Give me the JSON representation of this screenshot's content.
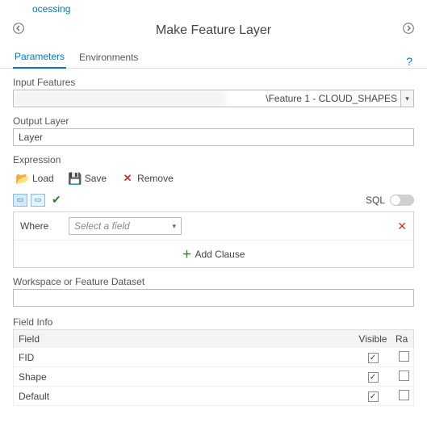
{
  "app_link": "ocessing",
  "title": "Make Feature Layer",
  "tabs": {
    "parameters": "Parameters",
    "environments": "Environments"
  },
  "labels": {
    "input_features": "Input Features",
    "output_layer": "Output Layer",
    "expression": "Expression",
    "workspace": "Workspace or Feature Dataset",
    "field_info": "Field Info"
  },
  "toolbar": {
    "load": "Load",
    "save": "Save",
    "remove": "Remove"
  },
  "sql": "SQL",
  "clause": {
    "where": "Where",
    "placeholder": "Select a field",
    "add": "Add Clause"
  },
  "input_features_value": "\\Feature 1 - CLOUD_SHAPES",
  "output_layer_value": "Layer",
  "workspace_value": "",
  "columns": {
    "field": "Field",
    "visible": "Visible",
    "ra": "Ra"
  },
  "rows": [
    {
      "name": "FID",
      "visible": true
    },
    {
      "name": "Shape",
      "visible": true
    },
    {
      "name": "Default",
      "visible": true
    }
  ]
}
